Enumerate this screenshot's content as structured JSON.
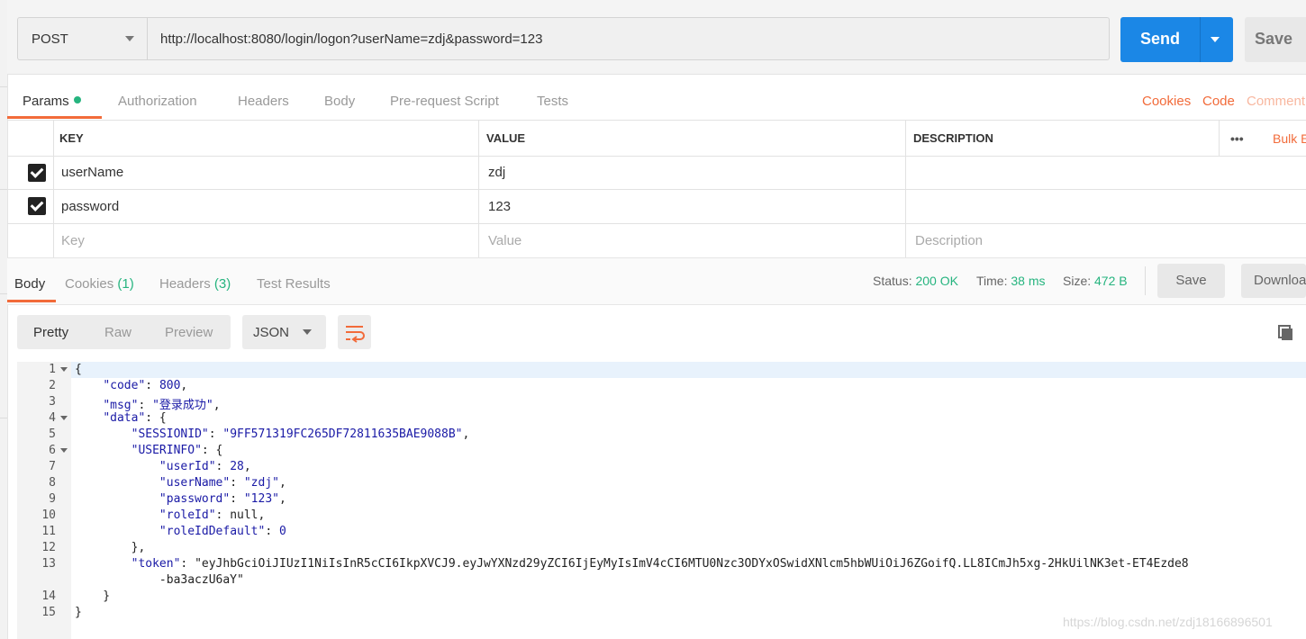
{
  "request": {
    "method": "POST",
    "url": "http://localhost:8080/login/logon?userName=zdj&password=123",
    "send_label": "Send",
    "save_label": "Save"
  },
  "request_tabs": [
    "Params",
    "Authorization",
    "Headers",
    "Body",
    "Pre-request Script",
    "Tests"
  ],
  "request_links": [
    "Cookies",
    "Code",
    "Comment"
  ],
  "params_table": {
    "headers": [
      "KEY",
      "VALUE",
      "DESCRIPTION"
    ],
    "more": "•••",
    "bulk_edit": "Bulk E",
    "rows": [
      {
        "checked": true,
        "key": "userName",
        "value": "zdj",
        "description": ""
      },
      {
        "checked": true,
        "key": "password",
        "value": "123",
        "description": ""
      }
    ],
    "placeholder": {
      "key": "Key",
      "value": "Value",
      "description": "Description"
    }
  },
  "response": {
    "tabs": {
      "body": "Body",
      "cookies": "Cookies",
      "cookies_count": "(1)",
      "headers": "Headers",
      "headers_count": "(3)",
      "tests": "Test Results"
    },
    "status_label": "Status:",
    "status_value": "200 OK",
    "time_label": "Time:",
    "time_value": "38 ms",
    "size_label": "Size:",
    "size_value": "472 B",
    "save_label": "Save",
    "download_label": "Download"
  },
  "view": {
    "modes": [
      "Pretty",
      "Raw",
      "Preview"
    ],
    "format": "JSON"
  },
  "body_lines": [
    "{",
    "    \"code\": 800,",
    "    \"msg\": \"登录成功\",",
    "    \"data\": {",
    "        \"SESSIONID\": \"9FF571319FC265DF72811635BAE9088B\",",
    "        \"USERINFO\": {",
    "            \"userId\": 28,",
    "            \"userName\": \"zdj\",",
    "            \"password\": \"123\",",
    "            \"roleId\": null,",
    "            \"roleIdDefault\": 0",
    "        },",
    "        \"token\": \"eyJhbGciOiJIUzI1NiIsInR5cCI6IkpXVCJ9.eyJwYXNzd29yZCI6IjEyMyIsImV4cCI6MTU0Nzc3ODYxOSwidXNlcm5hbWUiOiJ6ZGoifQ.LL8ICmJh5xg-2HkUilNK3et-ET4Ezde8",
    "            -ba3aczU6aY\"",
    "    }",
    "}"
  ],
  "line_numbers": [
    "1",
    "2",
    "3",
    "4",
    "5",
    "6",
    "7",
    "8",
    "9",
    "10",
    "11",
    "12",
    "13",
    "",
    "14",
    "15"
  ],
  "watermark": "https://blog.csdn.net/zdj18166896501"
}
